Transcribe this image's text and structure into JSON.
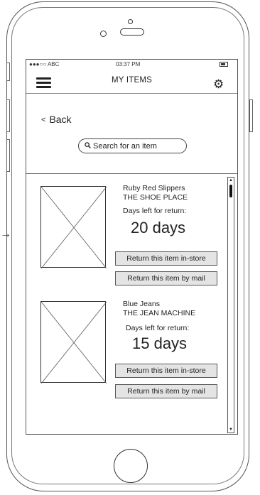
{
  "status_bar": {
    "carrier": "●●●○○ ABC",
    "time": "03:37 PM"
  },
  "navbar": {
    "title": "MY ITEMS",
    "menu_icon": "hamburger-menu-icon",
    "settings_icon": "gear-icon"
  },
  "back": {
    "label": "Back"
  },
  "search": {
    "placeholder": "Search for an item"
  },
  "items": [
    {
      "name": "Ruby Red Slippers",
      "store": "THE SHOE PLACE",
      "days_label": "Days left for return:",
      "days": "20 days",
      "return_store_label": "Return this item in-store",
      "return_mail_label": "Return this item by mail"
    },
    {
      "name": "Blue Jeans",
      "store": "THE JEAN MACHINE",
      "days_label": "Days left for return:",
      "days": "15 days",
      "return_store_label": "Return this item in-store",
      "return_mail_label": "Return this item by mail"
    }
  ],
  "colors": {
    "button_bg": "#e4e4e4",
    "border": "#555555"
  }
}
